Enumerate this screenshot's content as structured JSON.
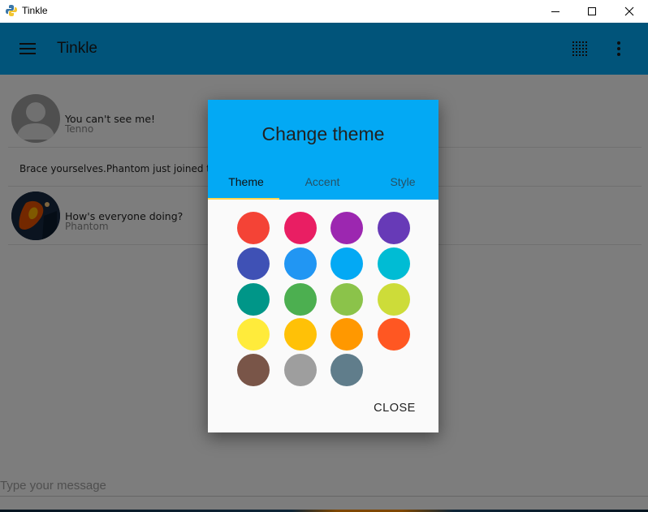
{
  "window": {
    "title": "Tinkle",
    "icon": "python-icon",
    "controls": [
      "minimize-icon",
      "maximize-icon",
      "close-icon"
    ]
  },
  "appbar": {
    "title": "Tinkle",
    "color": "#03a9f4",
    "icons": [
      "menu-icon",
      "dots-grid-icon",
      "more-vert-icon"
    ]
  },
  "messages": [
    {
      "text": "You can't see me!",
      "sender": "Tenno",
      "avatar": "default-avatar"
    },
    {
      "text": "Brace yourselves.Phantom just joined the chat",
      "type": "system"
    },
    {
      "text": "How's everyone doing?",
      "sender": "Phantom",
      "avatar": "photo-avatar"
    }
  ],
  "compose": {
    "placeholder": "Type your message",
    "value": ""
  },
  "dialog": {
    "title": "Change theme",
    "tabs": [
      {
        "label": "Theme",
        "active": true
      },
      {
        "label": "Accent",
        "active": false
      },
      {
        "label": "Style",
        "active": false
      }
    ],
    "indicator_color": "#ffd54f",
    "swatches": [
      "#f44336",
      "#e91e63",
      "#9c27b0",
      "#673ab7",
      "#3f51b5",
      "#2196f3",
      "#03a9f4",
      "#00bcd4",
      "#009688",
      "#4caf50",
      "#8bc34a",
      "#cddc39",
      "#ffeb3b",
      "#ffc107",
      "#ff9800",
      "#ff5722",
      "#795548",
      "#9e9e9e",
      "#607d8b"
    ],
    "close_label": "CLOSE"
  }
}
